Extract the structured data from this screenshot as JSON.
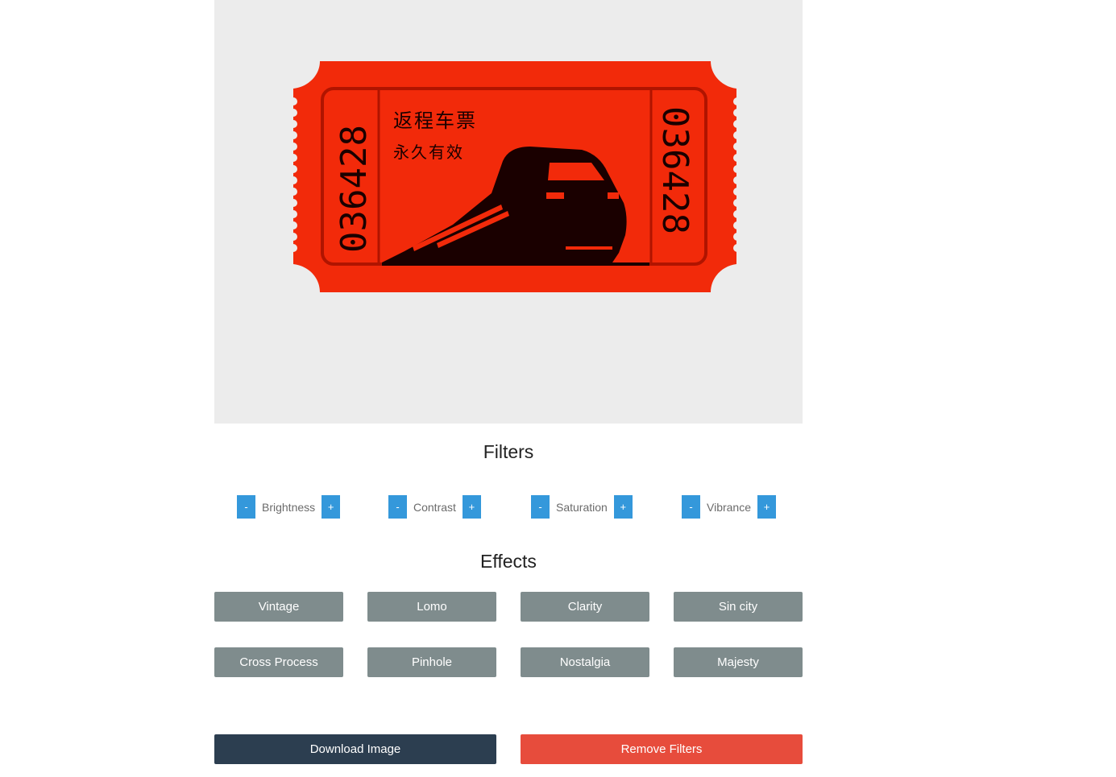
{
  "image": {
    "ticket": {
      "title_line1": "返程车票",
      "title_line2": "永久有效",
      "number_left": "036428",
      "number_right": "036428",
      "colors": {
        "ticket": "#f22a0a",
        "ink": "#1a0000",
        "frame": "#b01400"
      }
    }
  },
  "filters": {
    "title": "Filters",
    "items": [
      {
        "label": "Brightness",
        "minus": "-",
        "plus": "+"
      },
      {
        "label": "Contrast",
        "minus": "-",
        "plus": "+"
      },
      {
        "label": "Saturation",
        "minus": "-",
        "plus": "+"
      },
      {
        "label": "Vibrance",
        "minus": "-",
        "plus": "+"
      }
    ]
  },
  "effects": {
    "title": "Effects",
    "items": [
      "Vintage",
      "Lomo",
      "Clarity",
      "Sin city",
      "Cross Process",
      "Pinhole",
      "Nostalgia",
      "Majesty"
    ]
  },
  "actions": {
    "download_label": "Download Image",
    "remove_label": "Remove Filters"
  },
  "colors": {
    "filter_button": "#3498db",
    "effect_button": "#7f8c8d",
    "download_button": "#2c3e50",
    "remove_button": "#e74c3c",
    "canvas_background": "#ececec"
  }
}
